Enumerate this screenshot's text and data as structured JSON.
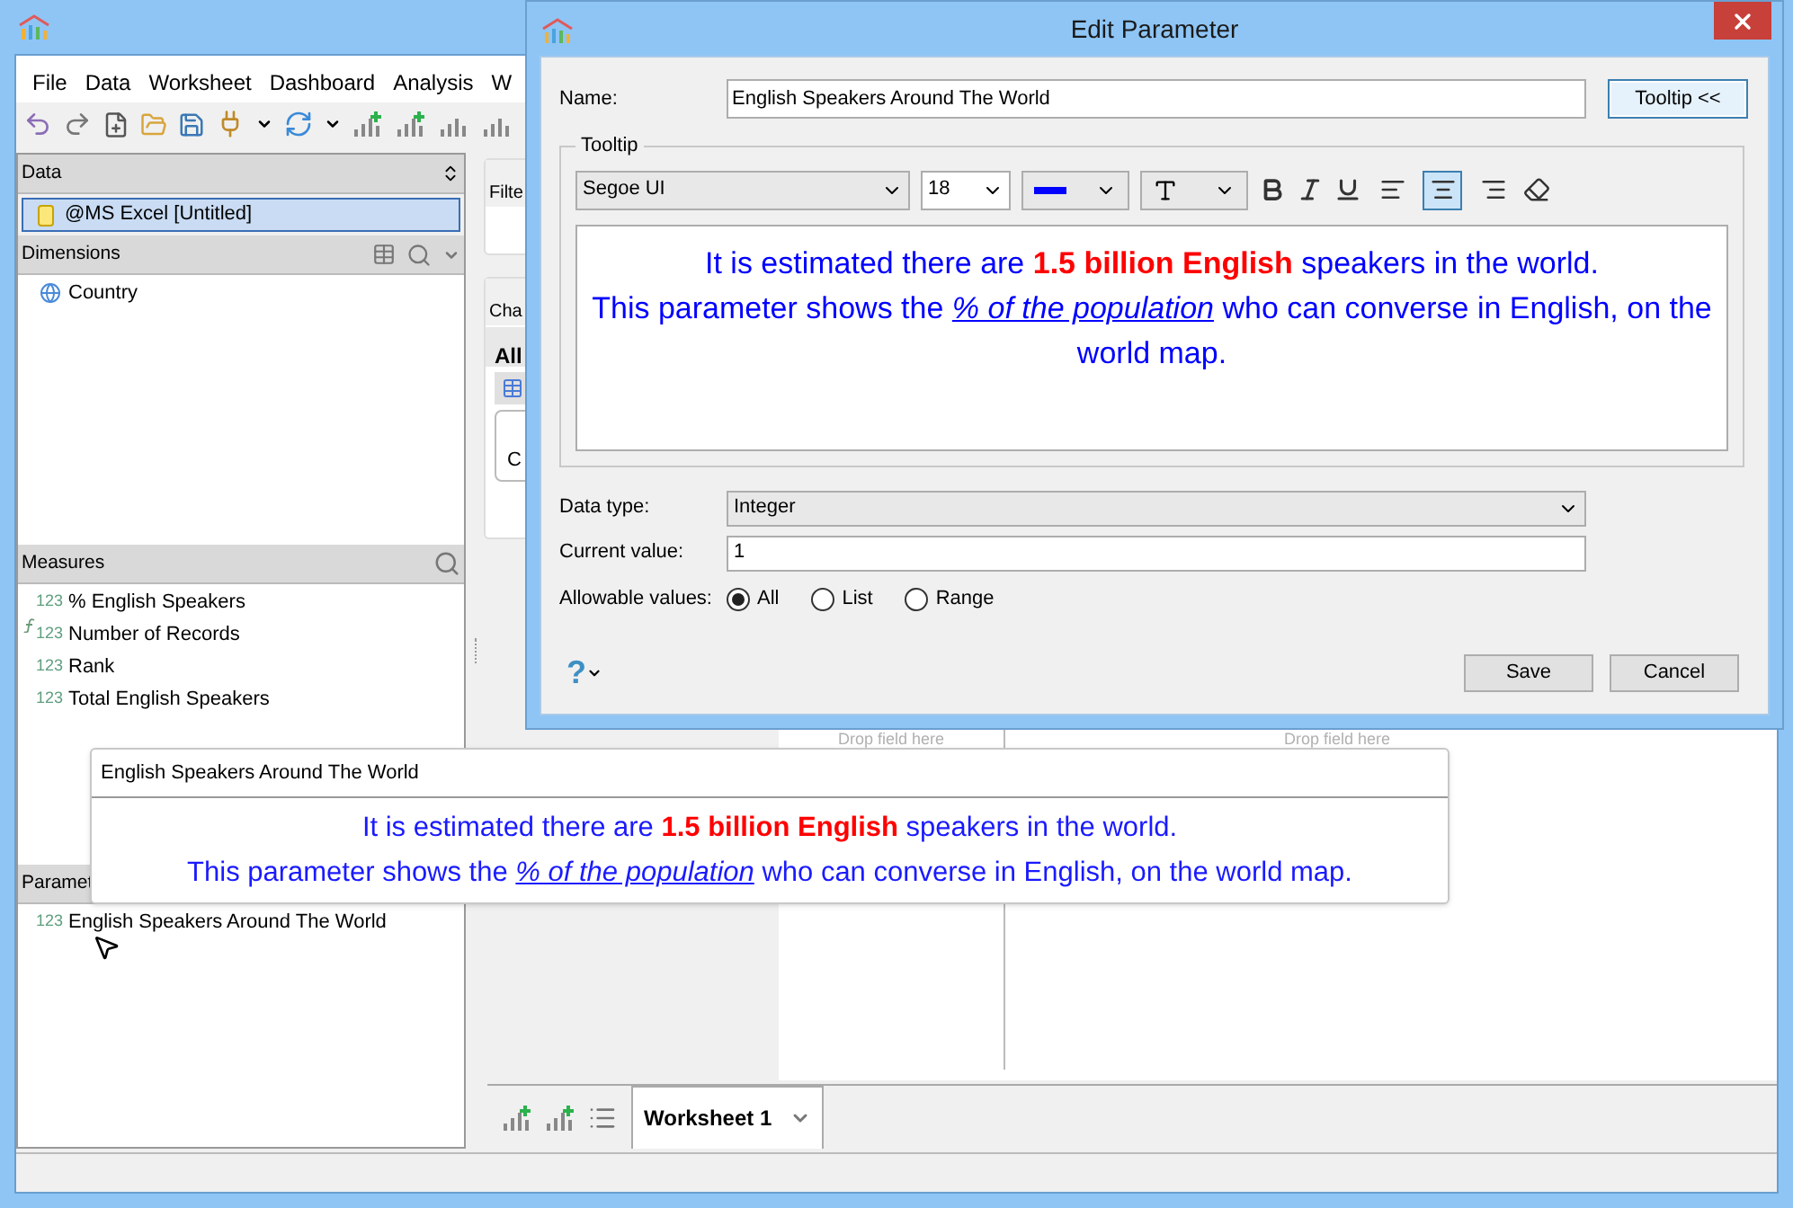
{
  "menu": [
    {
      "label": "File"
    },
    {
      "label": "Data"
    },
    {
      "label": "Worksheet"
    },
    {
      "label": "Dashboard"
    },
    {
      "label": "Analysis"
    },
    {
      "label": "W"
    }
  ],
  "data_panel": {
    "title": "Data",
    "source": {
      "label": "@MS Excel [Untitled]",
      "selected": true
    }
  },
  "dimensions": {
    "title": "Dimensions",
    "items": [
      {
        "label": "Country",
        "kind": "geo"
      }
    ]
  },
  "measures": {
    "title": "Measures",
    "items": [
      {
        "label": "% English Speakers",
        "kind": "number",
        "type_label": "123"
      },
      {
        "label": "Number of Records",
        "kind": "calculated",
        "type_label": "123"
      },
      {
        "label": "Rank",
        "kind": "number",
        "type_label": "123"
      },
      {
        "label": "Total English Speakers",
        "kind": "number",
        "type_label": "123"
      }
    ]
  },
  "parameters": {
    "title": "Paramet",
    "items": [
      {
        "label": "English Speakers Around The World",
        "kind": "number",
        "type_label": "123"
      }
    ]
  },
  "filters_card": {
    "title": "Filte"
  },
  "chart_card": {
    "title": "Cha",
    "filter_label": "All",
    "button": "C"
  },
  "worksheet": {
    "drop_labels": [
      "Drop field here",
      "Drop field here"
    ]
  },
  "sheet_tabs": [
    {
      "label": "Worksheet 1",
      "selected": true
    }
  ],
  "dialog": {
    "title": "Edit Parameter",
    "name_label": "Name:",
    "name_value": "English Speakers Around The World",
    "tooltip_button": "Tooltip <<",
    "tooltip_group": "Tooltip",
    "font": "Segoe UI",
    "size": "18",
    "color": "#0000ff",
    "align": [
      {
        "kind": "left",
        "selected": false
      },
      {
        "kind": "center",
        "selected": true
      },
      {
        "kind": "right",
        "selected": false
      }
    ],
    "content": [
      "It is estimated there are **1.5 billion English** speakers in the world.",
      "This parameter shows the *% of the population* who can converse in English, on the world map."
    ],
    "data_type_label": "Data type:",
    "data_type": "Integer",
    "current_value_label": "Current value:",
    "current_value": "1",
    "allowable_label": "Allowable values:",
    "allowable": [
      {
        "label": "All",
        "selected": true
      },
      {
        "label": "List",
        "selected": false
      },
      {
        "label": "Range",
        "selected": false
      }
    ],
    "help": "?",
    "buttons": [
      {
        "label": "Save"
      },
      {
        "label": "Cancel"
      }
    ]
  },
  "tooltip_popup": {
    "title": "English Speakers Around The World",
    "content": [
      "It is estimated there are **1.5 billion English** speakers in the world.",
      "This parameter shows the *% of the population* who can converse in English, on the world map."
    ]
  }
}
